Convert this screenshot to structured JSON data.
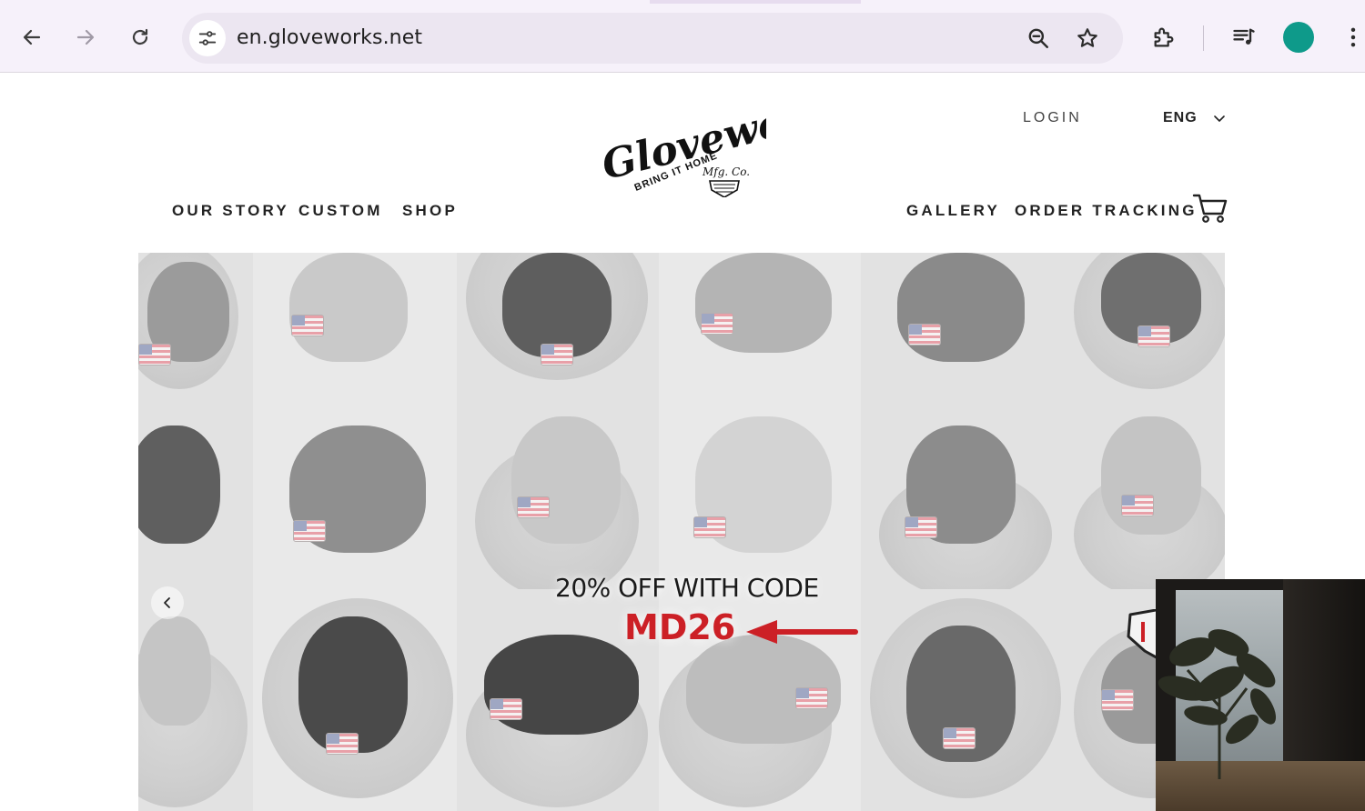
{
  "browser": {
    "url": "en.gloveworks.net",
    "back_icon": "arrow-left-icon",
    "forward_icon": "arrow-right-icon",
    "reload_icon": "reload-icon",
    "site_info_icon": "tune-icon",
    "zoom_icon": "zoom-icon",
    "bookmark_icon": "star-icon",
    "extensions_icon": "puzzle-icon",
    "media_icon": "media-controls-icon",
    "menu_icon": "kebab-menu-icon",
    "profile_color": "#0e9a8a"
  },
  "header": {
    "logo_alt": "Gloveworks Bring It Home Mfg. Co.",
    "login_label": "LOGIN",
    "language_label": "ENG",
    "nav_left": [
      "OUR STORY",
      "CUSTOM",
      "SHOP"
    ],
    "nav_right": [
      "GALLERY",
      "ORDER TRACKING"
    ],
    "cart_icon": "cart-icon"
  },
  "hero": {
    "promo_line1": "20% OFF WITH CODE",
    "promo_code": "MD26",
    "promo_color": "#cc2026",
    "prev_arrow_icon": "chevron-left-icon"
  },
  "pip_overlay": {
    "description_icon": "video-pip"
  }
}
